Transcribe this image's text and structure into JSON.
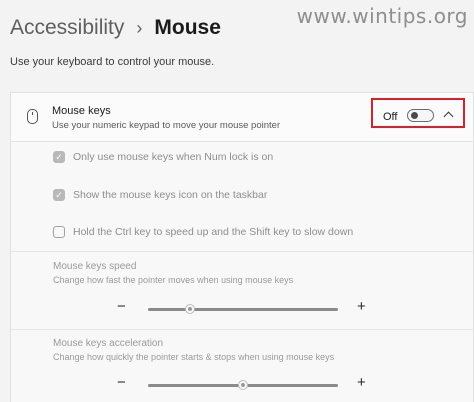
{
  "watermark": "www.wintips.org",
  "breadcrumb": {
    "parent": "Accessibility",
    "separator": "›",
    "current": "Mouse"
  },
  "subtitle": "Use your keyboard to control your mouse.",
  "mouse_keys": {
    "icon": "mouse-icon",
    "title": "Mouse keys",
    "description": "Use your numeric keypad to move your mouse pointer",
    "toggle_state": "Off",
    "toggle_on": false,
    "expanded": true,
    "highlight_color": "#d6202a"
  },
  "options": [
    {
      "label": "Only use mouse keys when Num lock is on",
      "checked": true,
      "disabled": true
    },
    {
      "label": "Show the mouse keys icon on the taskbar",
      "checked": true,
      "disabled": true
    },
    {
      "label": "Hold the Ctrl key to speed up and the Shift key to slow down",
      "checked": false,
      "disabled": true
    }
  ],
  "speed": {
    "title": "Mouse keys speed",
    "description": "Change how fast the pointer moves when using mouse keys",
    "minus": "−",
    "plus": "+",
    "value": 0.22
  },
  "acceleration": {
    "title": "Mouse keys acceleration",
    "description": "Change how quickly the pointer starts & stops when using mouse keys",
    "minus": "−",
    "plus": "+",
    "value": 0.5
  }
}
